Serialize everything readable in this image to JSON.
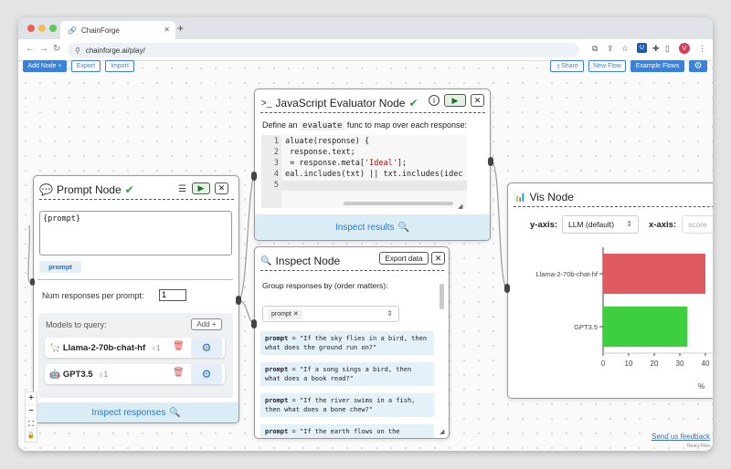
{
  "browser": {
    "tab_title": "ChainForge",
    "url": "chainforge.ai/play/",
    "profile_initial": "V"
  },
  "toolbar": {
    "add_node": "Add Node +",
    "export": "Export",
    "import": "Import",
    "share": "Share",
    "new_flow": "New Flow",
    "example_flows": "Example Flows"
  },
  "prompt_node": {
    "title": "Prompt Node",
    "template": "{prompt}",
    "var_tag": "prompt",
    "num_responses_label": "Num responses per prompt:",
    "num_responses_value": "1",
    "models_label": "Models to query:",
    "add_label": "Add +",
    "models": [
      {
        "name": "Llama-2-70b-chat-hf",
        "count": "1",
        "emoji": "🦙"
      },
      {
        "name": "GPT3.5",
        "count": "1",
        "emoji": "🤖"
      }
    ],
    "inspect_label": "Inspect responses"
  },
  "js_node": {
    "title": "JavaScript Evaluator Node",
    "desc_prefix": "Define an",
    "desc_code": "evaluate",
    "desc_suffix": "func to map over each response:",
    "code_lines": [
      {
        "n": "1",
        "text": "aluate(response) {"
      },
      {
        "n": "2",
        "text": " response.text;"
      },
      {
        "n": "3",
        "pre": " = response.meta[",
        "str": "'Ideal'",
        "post": "];"
      },
      {
        "n": "4",
        "text": "eal.includes(txt) || txt.includes(idec"
      },
      {
        "n": "5",
        "text": ""
      }
    ],
    "inspect_label": "Inspect results"
  },
  "inspect_node": {
    "title": "Inspect Node",
    "export_label": "Export data",
    "group_label": "Group responses by (order matters):",
    "group_tag": "prompt",
    "responses": [
      {
        "key": "prompt",
        "text": "\"If the sky flies in a bird, then what does the ground run on?\""
      },
      {
        "key": "prompt",
        "text": "\"If a song sings a bird, then what does a book read?\""
      },
      {
        "key": "prompt",
        "text": "\"If the river swims in a fish, then what does a bone chew?\""
      },
      {
        "key": "prompt",
        "text": "\"If the earth flows on the"
      }
    ]
  },
  "vis_node": {
    "title": "Vis Node",
    "y_axis_label": "y-axis:",
    "y_axis_value": "LLM (default)",
    "x_axis_label": "x-axis:",
    "x_axis_placeholder": "score",
    "x_unit": "%"
  },
  "chart_data": {
    "type": "bar",
    "orientation": "horizontal",
    "categories": [
      "Llama-2-70b-chat-hf",
      "GPT3.5"
    ],
    "values": [
      40,
      33
    ],
    "colors": [
      "#e05a61",
      "#3ecf3e"
    ],
    "xticks": [
      "0",
      "10",
      "20",
      "30",
      "40"
    ],
    "xlim": [
      0,
      40
    ],
    "xlabel": "%"
  },
  "footer": {
    "feedback": "Send us feedback",
    "attribution": "React Flow"
  },
  "colors": {
    "accent": "#3b82d6",
    "inspect_bg": "#daecf4",
    "check": "#2e9e3c"
  }
}
